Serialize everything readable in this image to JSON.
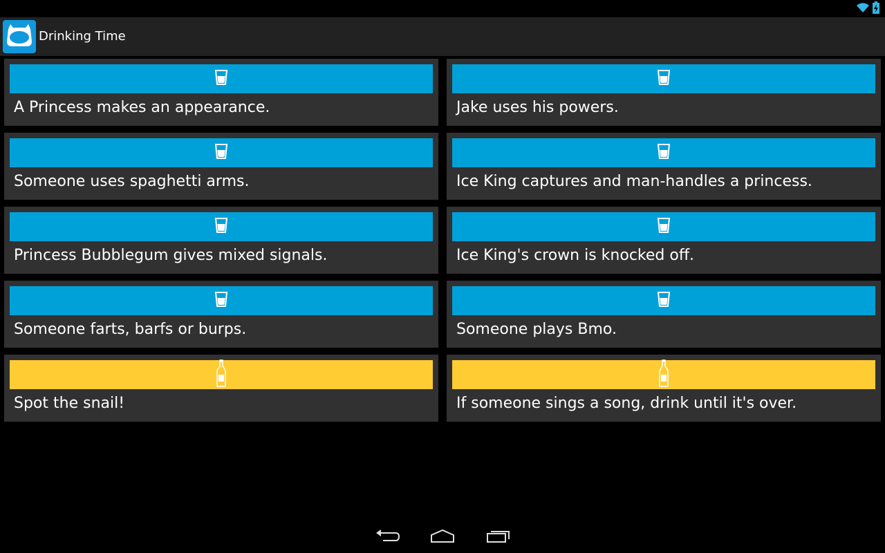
{
  "app": {
    "title": "Drinking Time",
    "icon": "finn-hat-icon"
  },
  "colors": {
    "action_bar": "#222222",
    "card_bg": "#313131",
    "shot_bar": "#00a1d8",
    "beer_bar": "#ffcc33"
  },
  "status_bar": {
    "icons": [
      "wifi-icon",
      "battery-charging-icon"
    ]
  },
  "cards": [
    {
      "text": "A Princess makes an appearance.",
      "drink": "shot-glass-icon"
    },
    {
      "text": "Jake uses his powers.",
      "drink": "shot-glass-icon"
    },
    {
      "text": "Someone uses spaghetti arms.",
      "drink": "shot-glass-icon"
    },
    {
      "text": "Ice King captures and man-handles a princess.",
      "drink": "shot-glass-icon"
    },
    {
      "text": "Princess Bubblegum gives mixed signals.",
      "drink": "shot-glass-icon"
    },
    {
      "text": "Ice King's crown is knocked off.",
      "drink": "shot-glass-icon"
    },
    {
      "text": "Someone farts, barfs or burps.",
      "drink": "shot-glass-icon"
    },
    {
      "text": "Someone plays Bmo.",
      "drink": "shot-glass-icon"
    },
    {
      "text": "Spot the snail!",
      "drink": "beer-bottle-icon"
    },
    {
      "text": "If someone sings a song, drink until it's over.",
      "drink": "beer-bottle-icon"
    }
  ],
  "nav_bar": {
    "buttons": [
      "back-icon",
      "home-icon",
      "recent-apps-icon"
    ]
  }
}
